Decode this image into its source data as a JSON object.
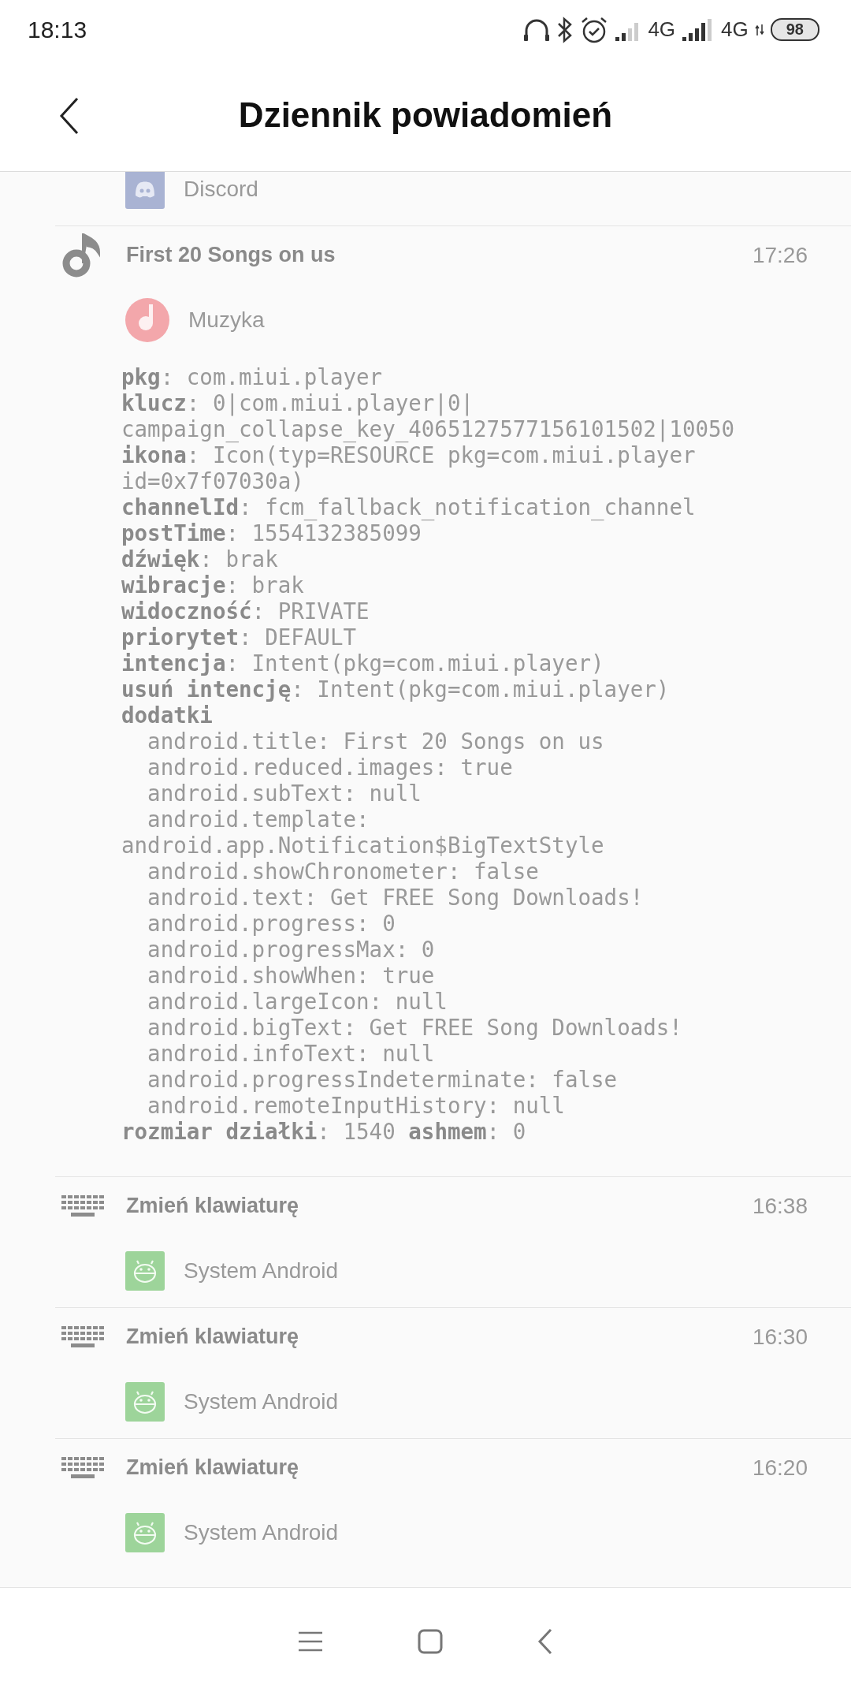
{
  "status_bar": {
    "time": "18:13",
    "network_1": "4G",
    "network_2": "4G",
    "battery": "98"
  },
  "header": {
    "title": "Dziennik powiadomień"
  },
  "notifications": [
    {
      "kind": "app_only",
      "app": {
        "kind": "discord",
        "name": "Discord"
      }
    },
    {
      "kind": "music",
      "title": "First 20 Songs on us",
      "time": "17:26",
      "app": {
        "kind": "music",
        "name": "Muzyka"
      },
      "details": [
        "**pkg**: com.miui.player",
        "**klucz**: 0|com.miui.player|0|",
        "campaign_collapse_key_4065127577156101502|10050",
        "**ikona**: Icon(typ=RESOURCE pkg=com.miui.player",
        "id=0x7f07030a)",
        "**channelId**: fcm_fallback_notification_channel",
        "**postTime**: 1554132385099",
        "**dźwięk**: brak",
        "**wibracje**: brak",
        "**widoczność**: PRIVATE",
        "**priorytet**: DEFAULT",
        "**intencja**: Intent(pkg=com.miui.player)",
        "**usuń intencję**: Intent(pkg=com.miui.player)",
        "**dodatki**",
        "  android.title: First 20 Songs on us",
        "  android.reduced.images: true",
        "  android.subText: null",
        "  android.template:",
        "android.app.Notification$BigTextStyle",
        "  android.showChronometer: false",
        "  android.text: Get FREE Song Downloads!",
        "  android.progress: 0",
        "  android.progressMax: 0",
        "  android.showWhen: true",
        "  android.largeIcon: null",
        "  android.bigText: Get FREE Song Downloads!",
        "  android.infoText: null",
        "  android.progressIndeterminate: false",
        "  android.remoteInputHistory: null",
        "**rozmiar działki**: 1540 **ashmem**: 0"
      ]
    },
    {
      "kind": "keyboard",
      "title": "Zmień klawiaturę",
      "time": "16:38",
      "app": {
        "kind": "android",
        "name": "System Android"
      }
    },
    {
      "kind": "keyboard",
      "title": "Zmień klawiaturę",
      "time": "16:30",
      "app": {
        "kind": "android",
        "name": "System Android"
      }
    },
    {
      "kind": "keyboard",
      "title": "Zmień klawiaturę",
      "time": "16:20",
      "app": {
        "kind": "android",
        "name": "System Android"
      }
    }
  ]
}
